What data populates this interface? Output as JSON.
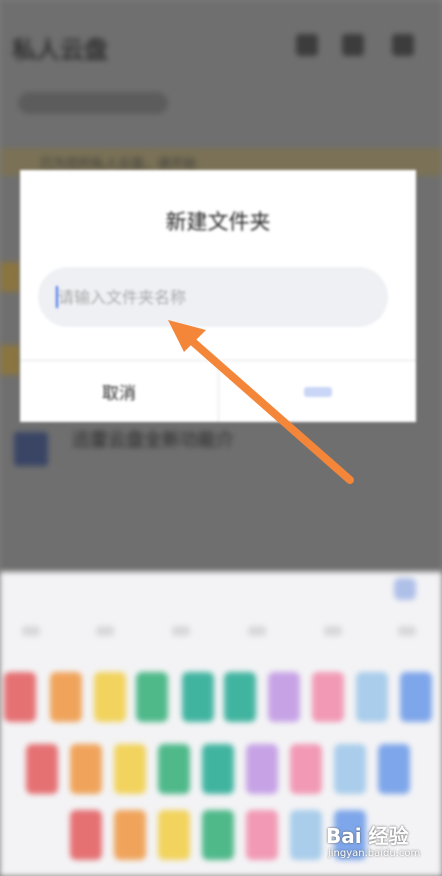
{
  "dialog": {
    "title": "新建文件夹",
    "input_placeholder": "请输入文件夹名称",
    "cancel_label": "取消"
  },
  "background": {
    "banner_text": "已为您的私人云盘，请开始",
    "list_item": "迅雷云盘全新功能介"
  },
  "colors": {
    "arrow": "#f4863a",
    "caret": "#3e6fe8",
    "key_colors": [
      "#e57173",
      "#f0a45b",
      "#f2d35e",
      "#4fb98a",
      "#41b4a0",
      "#c7a3e6",
      "#f29ab5",
      "#a9cdeb",
      "#7ea6ea"
    ]
  },
  "watermark": {
    "logo": "Bai 经验",
    "url": "jingyan.baidu.com"
  }
}
